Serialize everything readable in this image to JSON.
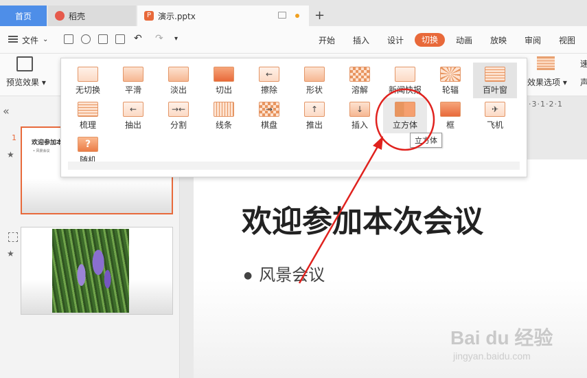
{
  "tabs": {
    "home": "首页",
    "daoke": "稻壳",
    "doc": "演示.pptx",
    "doc_icon": "P",
    "new_tab": "+"
  },
  "menubar": {
    "file": "文件",
    "items": [
      "开始",
      "插入",
      "设计",
      "切换",
      "动画",
      "放映",
      "审阅",
      "视图"
    ],
    "active": "切换"
  },
  "ribbon": {
    "preview_label": "预览效果",
    "effect_options_label": "效果选项",
    "cut_right_1": "速",
    "cut_right_2": "声"
  },
  "transitions": [
    {
      "label": "无切换"
    },
    {
      "label": "平滑"
    },
    {
      "label": "淡出"
    },
    {
      "label": "切出"
    },
    {
      "label": "擦除"
    },
    {
      "label": "形状"
    },
    {
      "label": "溶解"
    },
    {
      "label": "新闻快报"
    },
    {
      "label": "轮辐"
    },
    {
      "label": "百叶窗"
    },
    {
      "label": "梳理"
    },
    {
      "label": "抽出"
    },
    {
      "label": "分割"
    },
    {
      "label": "线条"
    },
    {
      "label": "棋盘"
    },
    {
      "label": "推出"
    },
    {
      "label": "插入"
    },
    {
      "label": "立方体"
    },
    {
      "label": "框"
    },
    {
      "label": "飞机"
    },
    {
      "label": "随机"
    }
  ],
  "tooltip": "立方体",
  "panel": {
    "collapse": "«",
    "slide1_num": "1",
    "slide1_title": "欢迎参加本",
    "slide1_bullet": "• 风景会议",
    "star": "★"
  },
  "ruler": "·3·1·2·1",
  "slide": {
    "title": "欢迎参加本次会议",
    "bullet": "风景会议"
  },
  "watermark": {
    "brand": "Bai du 经验",
    "url": "jingyan.baidu.com"
  },
  "colors": {
    "accent": "#e8693a",
    "annotation": "#e0221e",
    "home_tab": "#4e8ee8"
  }
}
